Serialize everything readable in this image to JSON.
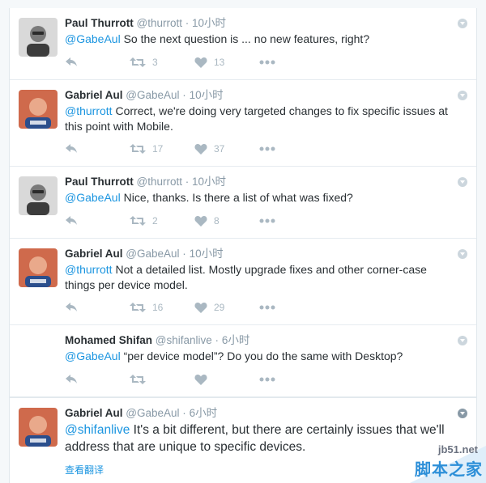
{
  "tweets": [
    {
      "name": "Paul Thurrott",
      "handle": "@thurrott",
      "sep": "·",
      "time": "10小时",
      "mention": "@GabeAul",
      "body": " So the next question is ... no new features, right?",
      "retweets": "3",
      "likes": "13",
      "avatar": "paul"
    },
    {
      "name": "Gabriel Aul",
      "handle": "@GabeAul",
      "sep": "·",
      "time": "10小时",
      "mention": "@thurrott",
      "body": " Correct, we're doing very targeted changes to fix specific issues at this point with Mobile.",
      "retweets": "17",
      "likes": "37",
      "avatar": "gabe"
    },
    {
      "name": "Paul Thurrott",
      "handle": "@thurrott",
      "sep": "·",
      "time": "10小时",
      "mention": "@GabeAul",
      "body": " Nice, thanks. Is there a list of what was fixed?",
      "retweets": "2",
      "likes": "8",
      "avatar": "paul"
    },
    {
      "name": "Gabriel Aul",
      "handle": "@GabeAul",
      "sep": "·",
      "time": "10小时",
      "mention": "@thurrott",
      "body": " Not a detailed list. Mostly upgrade fixes and other corner-case things per device model.",
      "retweets": "16",
      "likes": "29",
      "avatar": "gabe"
    },
    {
      "name": "Mohamed Shifan",
      "handle": "@shifanlive",
      "sep": "·",
      "time": "6小时",
      "mention": "@GabeAul",
      "body": " “per device model”? Do you do the same with Desktop?",
      "retweets": "",
      "likes": "",
      "avatar": "none"
    }
  ],
  "last_tweet": {
    "name": "Gabriel Aul",
    "handle": "@GabeAul",
    "sep": "·",
    "time": "6小时",
    "mention": "@shifanlive",
    "body": " It's a bit different, but there are certainly issues that we'll address that are unique to specific devices.",
    "translate_label": "查看翻译"
  },
  "watermark": {
    "url": "jb51.net",
    "text": "脚本之家"
  },
  "colors": {
    "link": "#1b95e0",
    "muted": "#8899a6",
    "action": "#aab8c2"
  }
}
